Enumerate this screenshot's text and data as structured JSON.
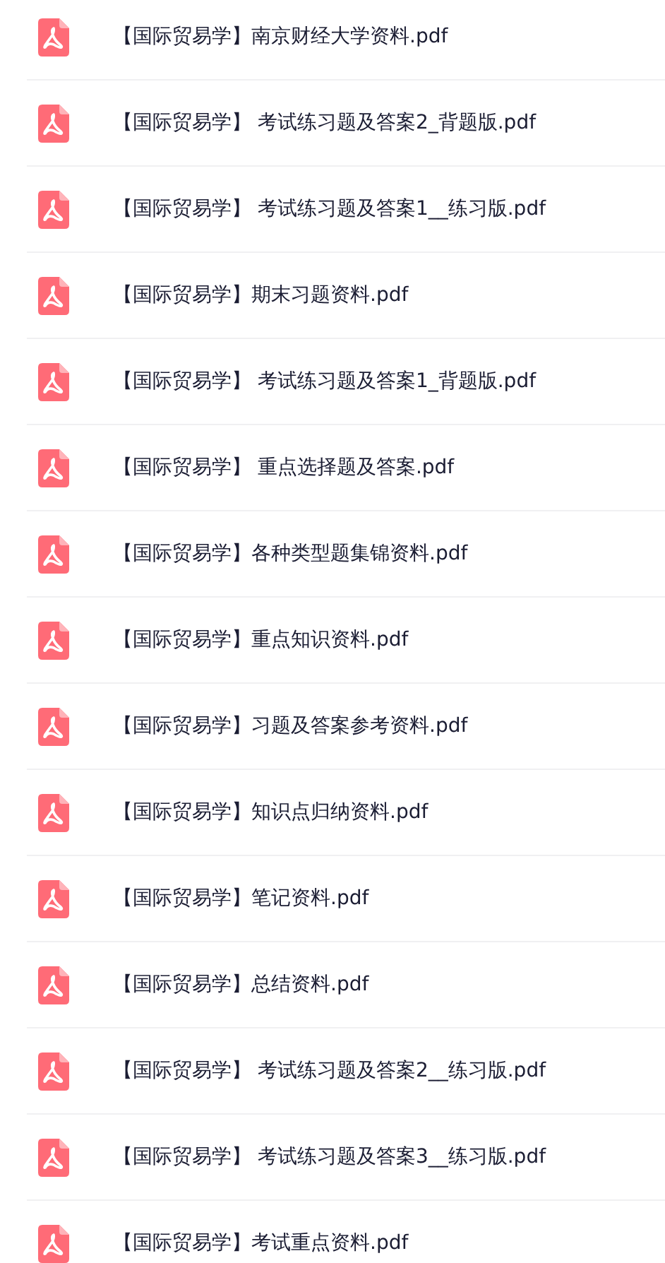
{
  "files": [
    {
      "name": "【国际贸易学】南京财经大学资料.pdf"
    },
    {
      "name": "【国际贸易学】 考试练习题及答案2_背题版.pdf"
    },
    {
      "name": "【国际贸易学】 考试练习题及答案1__练习版.pdf"
    },
    {
      "name": "【国际贸易学】期末习题资料.pdf"
    },
    {
      "name": "【国际贸易学】 考试练习题及答案1_背题版.pdf"
    },
    {
      "name": "【国际贸易学】 重点选择题及答案.pdf"
    },
    {
      "name": "【国际贸易学】各种类型题集锦资料.pdf"
    },
    {
      "name": "【国际贸易学】重点知识资料.pdf"
    },
    {
      "name": "【国际贸易学】习题及答案参考资料.pdf"
    },
    {
      "name": "【国际贸易学】知识点归纳资料.pdf"
    },
    {
      "name": "【国际贸易学】笔记资料.pdf"
    },
    {
      "name": "【国际贸易学】总结资料.pdf"
    },
    {
      "name": "【国际贸易学】 考试练习题及答案2__练习版.pdf"
    },
    {
      "name": "【国际贸易学】 考试练习题及答案3__练习版.pdf"
    },
    {
      "name": "【国际贸易学】考试重点资料.pdf"
    }
  ]
}
